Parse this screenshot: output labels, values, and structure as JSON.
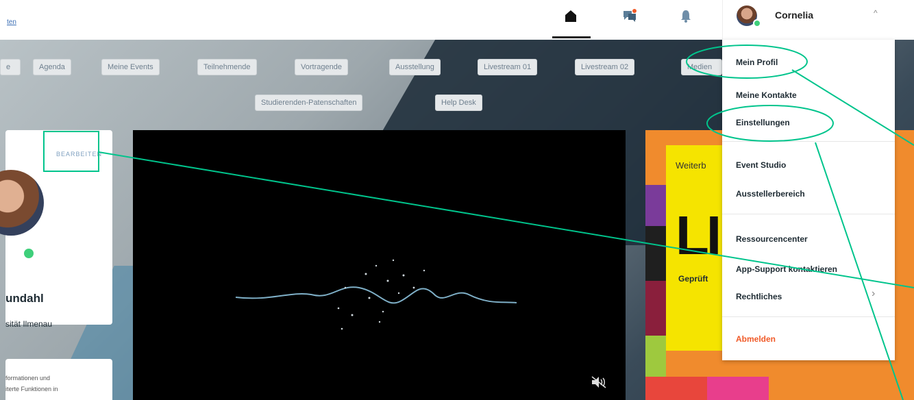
{
  "topbar": {
    "link_text": "ten",
    "user_name": "Cornelia"
  },
  "tabs": [
    "e",
    "Agenda",
    "Meine Events",
    "Teilnehmende",
    "Vortragende",
    "Ausstellung",
    "Livestream 01",
    "Livestream 02",
    "Medien",
    "Studierenden-Patenschaften",
    "Help Desk"
  ],
  "profile": {
    "edit_label": "BEARBEITEN",
    "name": "undahl",
    "org": "sität Ilmenau"
  },
  "info": {
    "text": "formationen und\niterte Funktionen in"
  },
  "promo": {
    "line1": "Weiterb",
    "big": "LI",
    "line2": "Geprüft"
  },
  "menu": {
    "items": [
      "Mein Profil",
      "Meine Kontakte",
      "Einstellungen",
      "Event Studio",
      "Ausstellerbereich",
      "Ressourcencenter",
      "App-Support kontaktieren",
      "Rechtliches",
      "Abmelden"
    ],
    "chevron": "›"
  },
  "icons": [
    "home-icon",
    "chat-icon",
    "bell-icon",
    "chevron-up-icon",
    "mute-icon"
  ],
  "colors": {
    "accent": "#00c48c",
    "logout": "#f05a28",
    "online": "#3ecf7a"
  }
}
